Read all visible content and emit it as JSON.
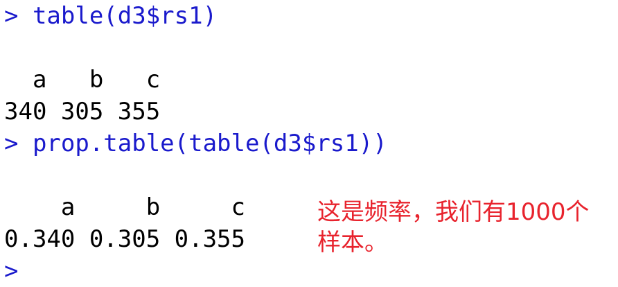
{
  "console": {
    "lines": [
      {
        "kind": "cmd",
        "text": "> table(d3$rs1)"
      },
      {
        "kind": "out",
        "text": ""
      },
      {
        "kind": "out",
        "text": "  a   b   c "
      },
      {
        "kind": "out",
        "text": "340 305 355 "
      },
      {
        "kind": "cmd",
        "text": "> prop.table(table(d3$rs1))"
      },
      {
        "kind": "out",
        "text": ""
      },
      {
        "kind": "out",
        "text": "    a     b     c "
      },
      {
        "kind": "out",
        "text": "0.340 0.305 0.355 "
      },
      {
        "kind": "cmd",
        "text": "> "
      }
    ]
  },
  "annotation": {
    "text": "这是频率，我们有1000个样本。"
  },
  "colors": {
    "command": "#1a1acc",
    "output": "#000000",
    "annotation": "#e8232d"
  }
}
